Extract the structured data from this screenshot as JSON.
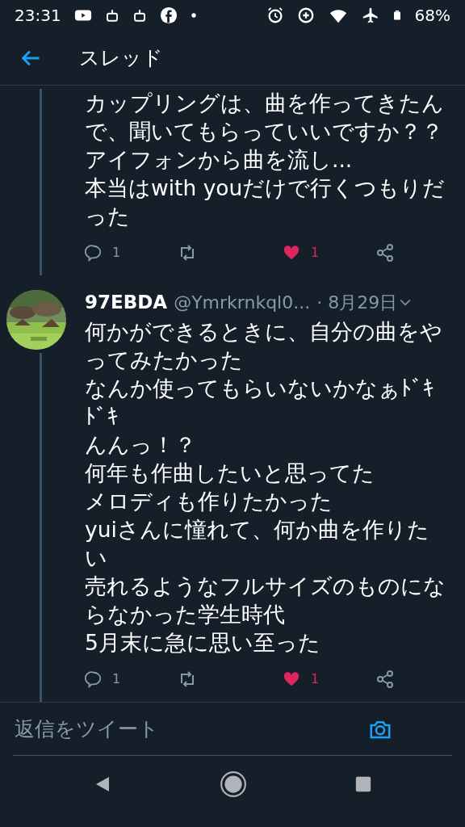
{
  "status_bar": {
    "time": "23:31",
    "battery": "68%"
  },
  "header": {
    "title": "スレッド"
  },
  "tweets": [
    {
      "show_author": false,
      "lines": [
        "カップリングは、曲を作ってきたんで、聞いてもらっていいですか？？",
        "アイフォンから曲を流し...",
        "本当はwith youだけで行くつもりだった"
      ],
      "replies": "1",
      "likes": "1",
      "liked": true
    },
    {
      "show_author": true,
      "name": "97EBDA",
      "handle": "@Ymrkrnkql0...",
      "date": "· 8月29日",
      "lines": [
        "何かができるときに、自分の曲をやってみたかった",
        "なんか使ってもらいないかなぁﾄﾞｷﾄﾞｷ",
        "んんっ！？",
        "何年も作曲したいと思ってた",
        "メロディも作りたかった",
        "yuiさんに憧れて、何か曲を作りたい",
        "売れるようなフルサイズのものにならなかった学生時代",
        "5月末に急に思い至った"
      ],
      "replies": "1",
      "likes": "1",
      "liked": true
    }
  ],
  "reply_box": {
    "placeholder": "返信をツイート"
  }
}
